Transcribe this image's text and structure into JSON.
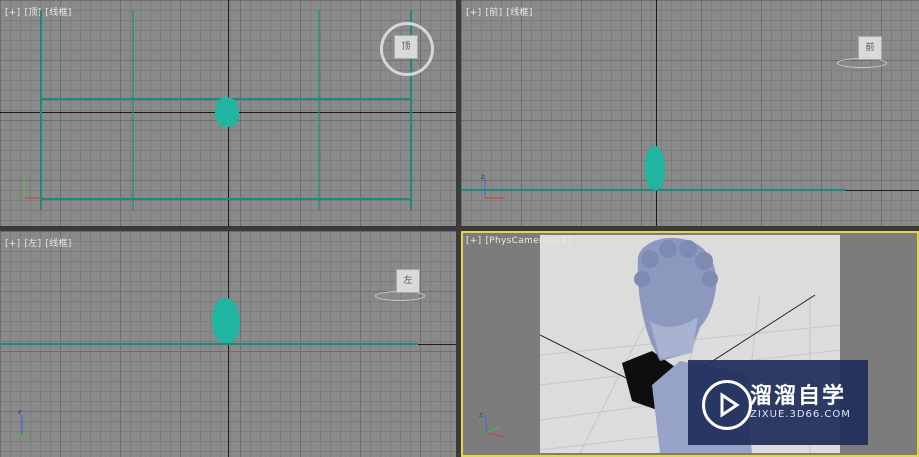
{
  "viewports": {
    "top": {
      "plus": "[+]",
      "view": "[顶]",
      "mode": "[线框]",
      "cube_label": "顶"
    },
    "front": {
      "plus": "[+]",
      "view": "[前]",
      "mode": "[线框]",
      "cube_label": "前"
    },
    "left": {
      "plus": "[+]",
      "view": "[左]",
      "mode": "[线框]",
      "cube_label": "左"
    },
    "camera": {
      "plus": "[+]",
      "view": "[PhysCamera001]"
    }
  },
  "axis_labels": {
    "x": "x",
    "y": "y",
    "z": "z"
  },
  "watermark": {
    "title": "溜溜自学",
    "subtitle": "ZIXUE.3D66.COM"
  },
  "colors": {
    "accent_teal": "#1fb5a0",
    "active_border": "#e3d44a",
    "logo_bg": "#1e2d5a"
  }
}
